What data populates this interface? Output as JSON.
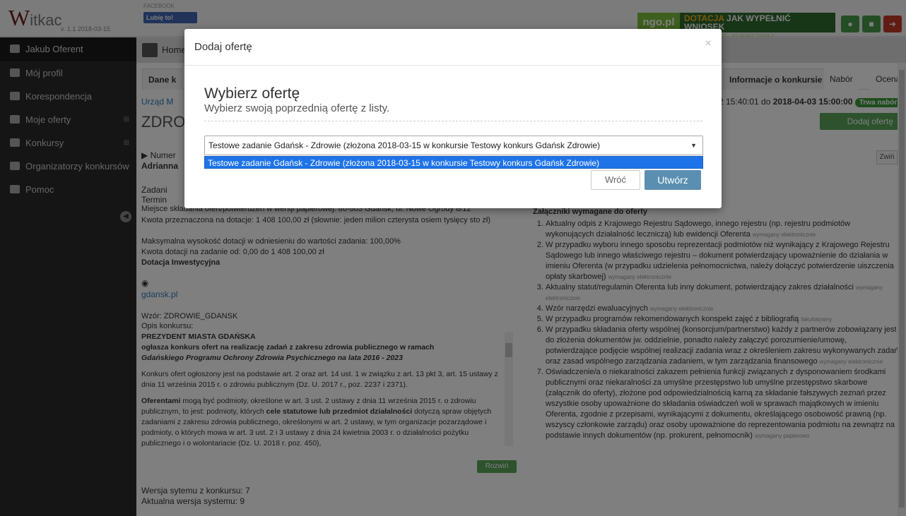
{
  "logo": {
    "brand_w": "W",
    "brand_rest": "itkac",
    "version": "v. 1.1 2018-03-15"
  },
  "facebook": {
    "label": "FACEBOOK",
    "like": "Lubię to!"
  },
  "promo": {
    "ngo": "ngo.pl",
    "dotacja": "DOTACJA",
    "title": "JAK WYPEŁNIĆ WNIOSEK",
    "sub": "PORADNIK PDF · KLIKNIJ TUTAJ"
  },
  "sidebar": {
    "user": "Jakub Oferent",
    "items": [
      {
        "label": "Mój profil"
      },
      {
        "label": "Korespondencja"
      },
      {
        "label": "Moje oferty",
        "plus": "⊞"
      },
      {
        "label": "Konkursy",
        "plus": "⊞"
      },
      {
        "label": "Organizatorzy konkursów"
      },
      {
        "label": "Pomoc"
      }
    ]
  },
  "breadcrumb": {
    "home": "Home"
  },
  "tabs": {
    "data": "Dane k",
    "info": "Informacje o konkursie",
    "nabor": "Nabór",
    "ocena": "Ocena"
  },
  "contest": {
    "office": "Urząd M",
    "dates_prefix": "2 15:40:01 do ",
    "dates_end": "2018-04-03 15:00:00",
    "status": "Trwa nabór",
    "code_title": "ZDRO",
    "add_offer": "Dodaj ofertę",
    "zwin": "Zwiń",
    "number_label": "▶ Numer",
    "person": "Adrianna",
    "zadanie": "Zadani",
    "termin": "Termin",
    "place": "Miejsce składania ofert/potwierdzeń w wersji papierowej: 80-803 Gdańsk, ul. Nowe Ogrody 8/12",
    "amount": "Kwota przeznaczona na dotacje: 1 408 100,00 zł (słownie: jeden milion czterysta osiem tysięcy sto zł)",
    "max_pct": "Maksymalna wysokość dotacji w odniesieniu do wartości zadania: 100,00%",
    "range": "Kwota dotacji na zadanie od: 0,00 do 1 408 100,00 zł",
    "invest": "Dotacja Inwestycyjna",
    "website": "gdansk.pl",
    "template": "Wzór: ZDROWIE_GDANSK",
    "desc_label": "Opis konkursu:",
    "desc_title": "PREZYDENT MIASTA GDAŃSKA",
    "desc_sub": "ogłasza konkurs ofert na realizację zadań z zakresu zdrowia publicznego w ramach",
    "desc_prog": "Gdańskiego Programu Ochrony Zdrowia Psychicznego na lata 2016 - 2023",
    "desc_p1": "Konkurs ofert ogłoszony jest na podstawie art. 2 oraz art. 14 ust. 1 w związku z art. 13 pkt 3, art. 15 ustawy z dnia 11 września 2015 r. o zdrowiu publicznym (Dz. U. 2017 r., poz. 2237 i 2371).",
    "desc_p2a": "Oferentami",
    "desc_p2b": " mogą być podmioty, określone w art. 3 ust. 2 ustawy z dnia 11 września 2015 r. o zdrowiu publicznym, to jest: podmioty, których ",
    "desc_p2c": "cele statutowe lub przedmiot działalności",
    "desc_p2d": " dotyczą spraw objętych zadaniami z zakresu zdrowia publicznego, określonymi w art. 2 ustawy, w tym organizacje pozarządowe i podmioty, o których mowa w art. 3 ust. 2 i 3 ustawy z dnia 24 kwietnia 2003 r. o działalności pożytku publicznego i o wolontariacie (Dz. U. 2018 r. poz. 450),",
    "rozwin": "Rozwiń",
    "ver_contest": "Wersja sytemu z konkursu: 7",
    "ver_current": "Aktualna wersja systemu: 9"
  },
  "attachments": {
    "head": "Załączniki wymagane do oferty",
    "items": [
      {
        "text": "Aktualny odpis z Krajowego Rejestru Sądowego, innego rejestru (np. rejestru podmiotów wykonujących działalność leczniczą) lub ewidencji Oferenta",
        "req": "wymagany elektronicznie"
      },
      {
        "text": "W przypadku wyboru innego sposobu reprezentacji podmiotów niż wynikający z Krajowego Rejestru Sądowego lub innego właściwego rejestru – dokument potwierdzający upoważnienie do działania w imieniu Oferenta (w przypadku udzielenia pełnomocnictwa, należy dołączyć potwierdzenie uiszczenia opłaty skarbowej)",
        "req": "wymagany elektronicznie"
      },
      {
        "text": "Aktualny statut/regulamin Oferenta lub inny dokument, potwierdzający zakres działalności",
        "req": "wymagany elektronicznie"
      },
      {
        "text": "Wzór narzędzi ewaluacyjnych",
        "req": "wymagany elektronicznie"
      },
      {
        "text": "W przypadku programów rekomendowanych konspekt zajęć z bibliografią",
        "req": "fakultatywny"
      },
      {
        "text": "W przypadku składania oferty wspólnej (konsorcjum/partnerstwo) każdy z partnerów zobowiązany jest do złożenia dokumentów jw. oddzielnie, ponadto należy załączyć porozumienie/umowę, potwierdzające podjęcie wspólnej realizacji zadania wraz z określeniem zakresu wykonywanych zadań oraz zasad wspólnego zarządzania zadaniem, w tym zarządzania finansowego",
        "req": "wymagany elektronicznie"
      },
      {
        "text": "Oświadczenie/a o niekaralności zakazem pełnienia funkcji związanych z dysponowaniem środkami publicznymi oraz niekaralności za umyślne przestępstwo lub umyślne przestępstwo skarbowe (załącznik do oferty), złożone pod odpowiedzialnością karną za składanie fałszywych zeznań przez wszystkie osoby upoważnione do składania oświadczeń woli w sprawach majątkowych w imieniu Oferenta, zgodnie z przepisami, wynikającymi z dokumentu, określającego osobowość prawną (np. wszyscy członkowie zarządu) oraz osoby upoważnione do reprezentowania podmiotu na zewnątrz na podstawie innych dokumentów (np. prokurent, pełnomocnik)",
        "req": "wymagany papierowo"
      }
    ]
  },
  "modal": {
    "title": "Dodaj ofertę",
    "close": "×",
    "heading": "Wybierz ofertę",
    "subheading": "Wybierz swoją poprzednią ofertę z listy.",
    "select_value": "Testowe zadanie Gdańsk - Zdrowie (złożona 2018-03-15 w konkursie Testowy konkurs Gdańsk Zdrowie)",
    "option_highlighted": "Testowe zadanie Gdańsk - Zdrowie (złożona 2018-03-15 w konkursie Testowy konkurs Gdańsk Zdrowie)",
    "back_label": "Wróć",
    "create_label": "Utwórz"
  },
  "colors": {
    "accent_green": "#5aa45a",
    "primary_blue": "#5b8fb1",
    "option_highlight": "#1e73e8",
    "sidebar_bg": "#2b2b2b"
  }
}
